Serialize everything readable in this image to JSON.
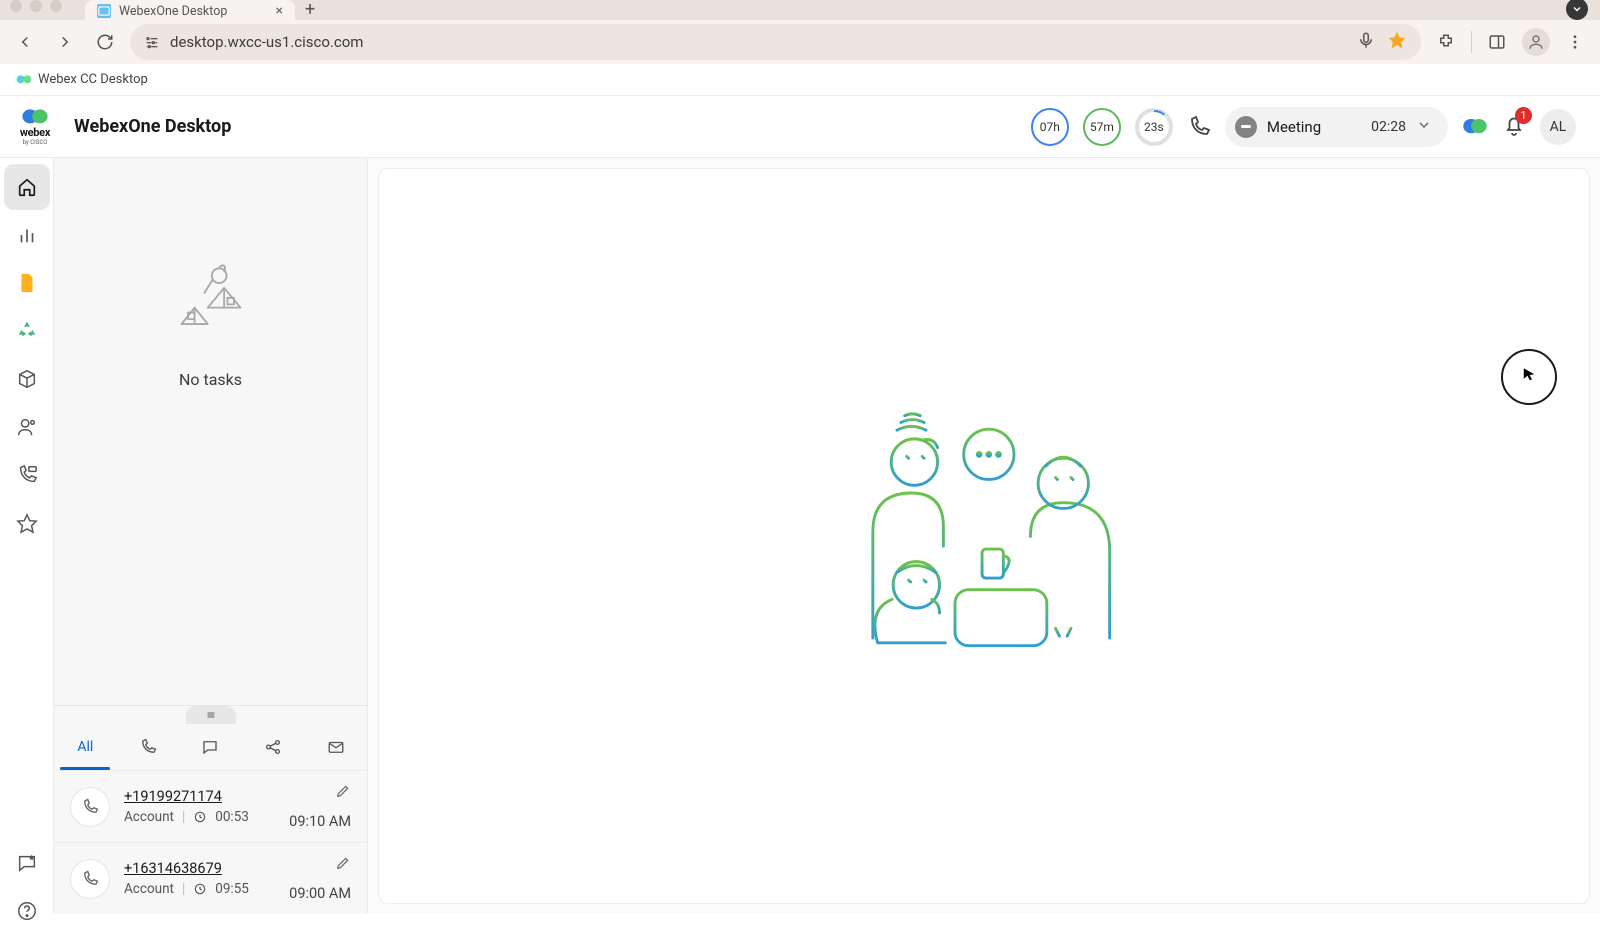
{
  "browser": {
    "tab_title": "WebexOne Desktop",
    "url": "desktop.wxcc-us1.cisco.com",
    "bookmark": "Webex CC Desktop"
  },
  "header": {
    "logo_text": "webex",
    "logo_sub": "by CISCO",
    "app_title": "WebexOne Desktop",
    "timers": {
      "hours": "07h",
      "mins": "57m",
      "secs": "23s"
    },
    "status_label": "Meeting",
    "status_time": "02:28",
    "notification_count": "1",
    "avatar_initials": "AL"
  },
  "task_panel": {
    "empty_text": "No tasks"
  },
  "history": {
    "tabs": {
      "all": "All"
    },
    "items": [
      {
        "number": "+19199271174",
        "type_label": "Account",
        "duration": "00:53",
        "time": "09:10 AM"
      },
      {
        "number": "+16314638679",
        "type_label": "Account",
        "duration": "09:55",
        "time": "09:00 AM"
      }
    ]
  }
}
